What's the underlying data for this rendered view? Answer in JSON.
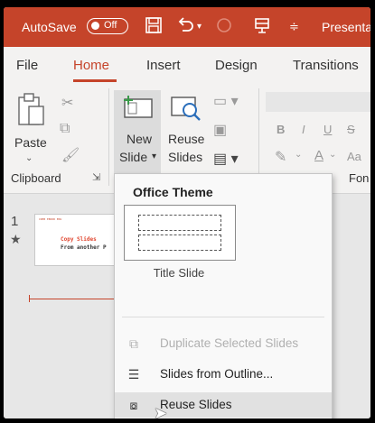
{
  "titlebar": {
    "autosave_label": "AutoSave",
    "autosave_state": "Off",
    "save_icon": "save-icon",
    "undo_icon": "undo-icon",
    "redo_icon": "redo-icon",
    "present_icon": "present-icon",
    "customize_icon": "customize-qat-icon",
    "doc_title": "Presentat"
  },
  "tabs": [
    {
      "label": "File"
    },
    {
      "label": "Home",
      "active": true
    },
    {
      "label": "Insert"
    },
    {
      "label": "Design"
    },
    {
      "label": "Transitions"
    }
  ],
  "ribbon": {
    "paste_label": "Paste",
    "new_slide_line1": "New",
    "new_slide_line2": "Slide",
    "reuse_line1": "Reuse",
    "reuse_line2": "Slides",
    "clipboard_group": "Clipboard",
    "font_group": "Fon",
    "font_buttons": [
      "B",
      "I",
      "U",
      "S"
    ],
    "font_color_label": "A",
    "aa_label": "Aa"
  },
  "slide_pane": {
    "slide_number": "1",
    "star": "★",
    "thumb_top_text": "CRE8 EBOOK EDU",
    "thumb_line1": "Copy Slides",
    "thumb_line2": "From another P"
  },
  "dropdown": {
    "heading": "Office Theme",
    "layout_label": "Title Slide",
    "items": [
      {
        "label": "Duplicate Selected Slides",
        "icon": "duplicate-slides-icon",
        "disabled": true
      },
      {
        "label": "Slides from Outline...",
        "icon": "outline-icon",
        "disabled": false
      },
      {
        "label": "Reuse Slides",
        "icon": "reuse-slides-icon",
        "disabled": false,
        "hover": true
      }
    ]
  },
  "colors": {
    "accent": "#c5442a",
    "ribbon_bg": "#f3f2f1"
  }
}
